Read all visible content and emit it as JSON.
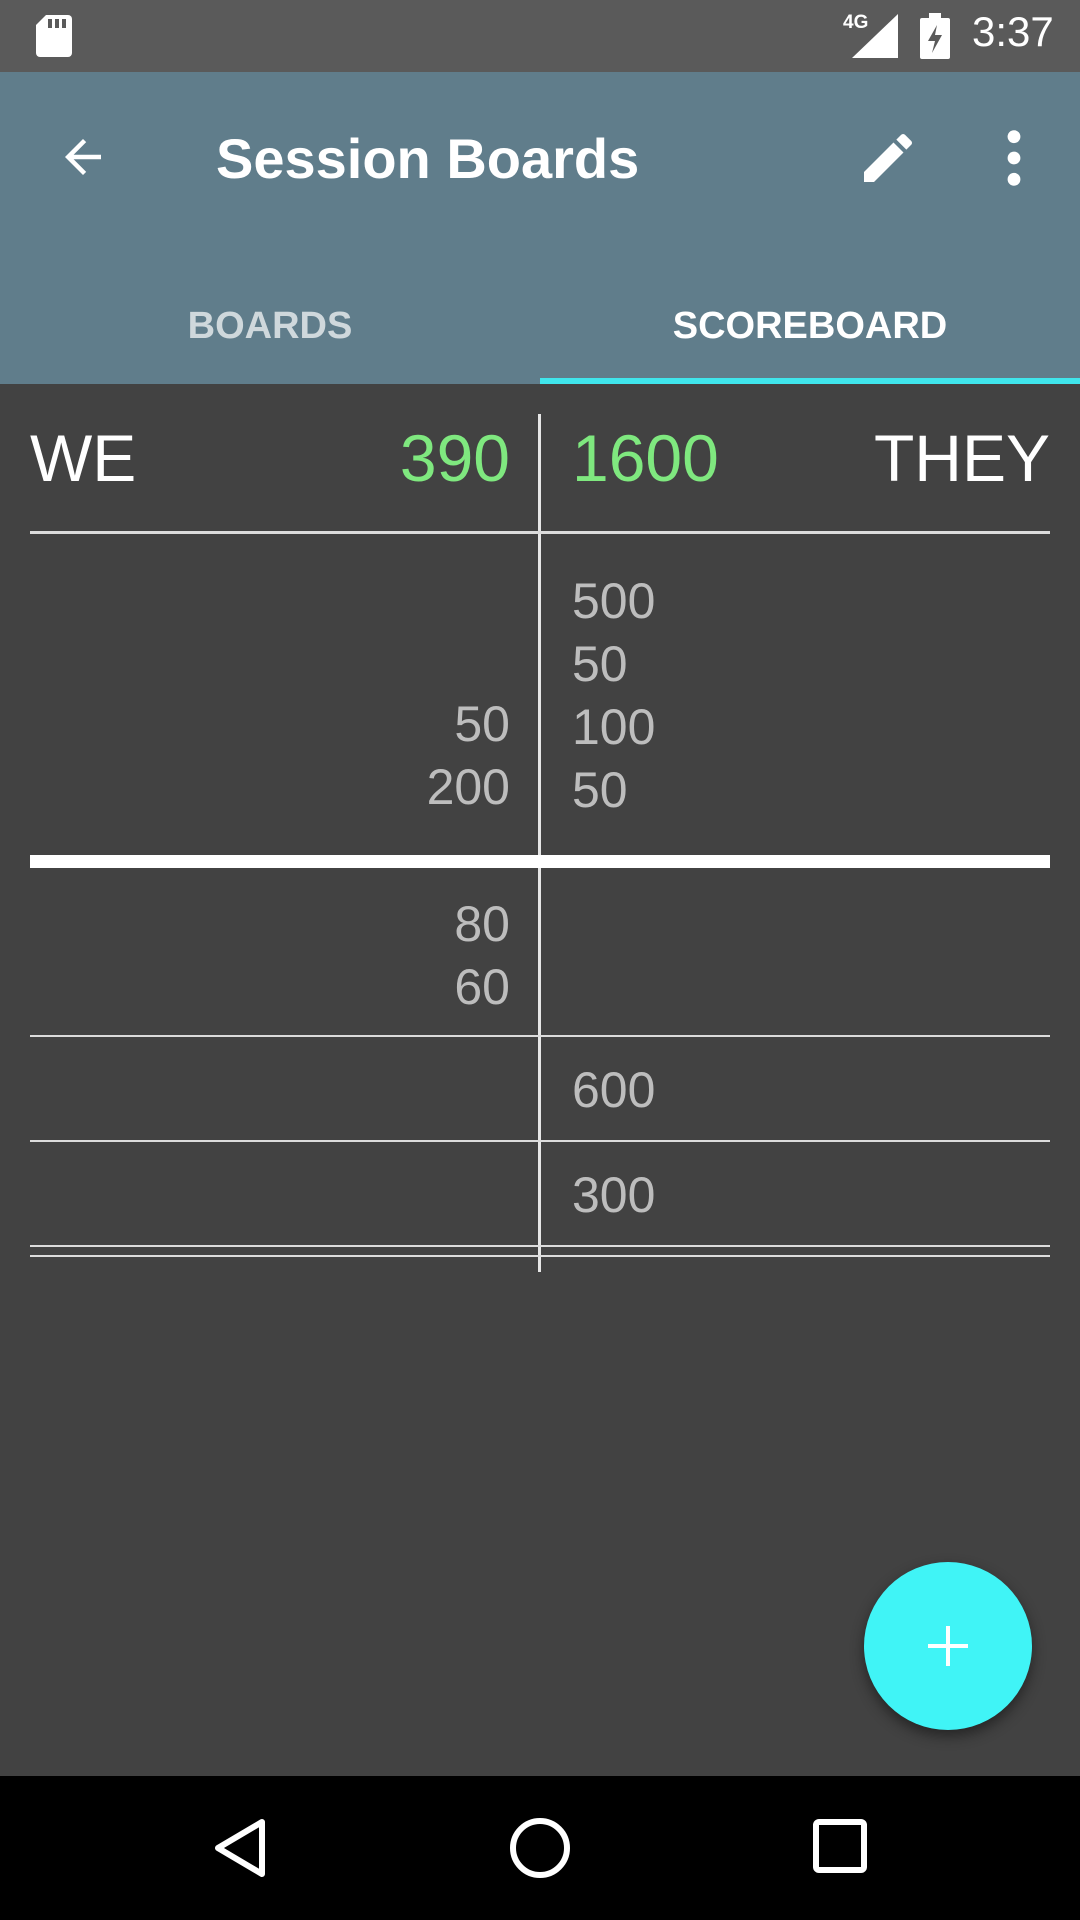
{
  "status_bar": {
    "time": "3:37",
    "network": "4G",
    "icons": [
      "sd-card-icon",
      "signal-icon",
      "battery-charging-icon"
    ]
  },
  "app_bar": {
    "title": "Session Boards",
    "icons": [
      "back-arrow-icon",
      "edit-pencil-icon",
      "more-vert-icon"
    ]
  },
  "tabs": [
    {
      "label": "BOARDS",
      "selected": false
    },
    {
      "label": "SCOREBOARD",
      "selected": true
    }
  ],
  "scoreboard": {
    "we": {
      "label": "WE",
      "total": "390"
    },
    "they": {
      "label": "THEY",
      "total": "1600"
    },
    "above_line": {
      "we": [
        "50",
        "200"
      ],
      "they": [
        "500",
        "50",
        "100",
        "50"
      ]
    },
    "games": [
      {
        "we": [
          "80",
          "60"
        ],
        "they": []
      },
      {
        "we": [],
        "they": [
          "600"
        ]
      },
      {
        "we": [],
        "they": [
          "300"
        ]
      }
    ]
  },
  "fab": {
    "icon": "add-icon"
  },
  "nav_bar": {
    "icons": [
      "nav-back-icon",
      "nav-home-icon",
      "nav-recents-icon"
    ]
  },
  "colors": {
    "app_bar": "#607d8b",
    "accent": "#40f4f6",
    "total": "#7fe87f",
    "background": "#424242"
  }
}
